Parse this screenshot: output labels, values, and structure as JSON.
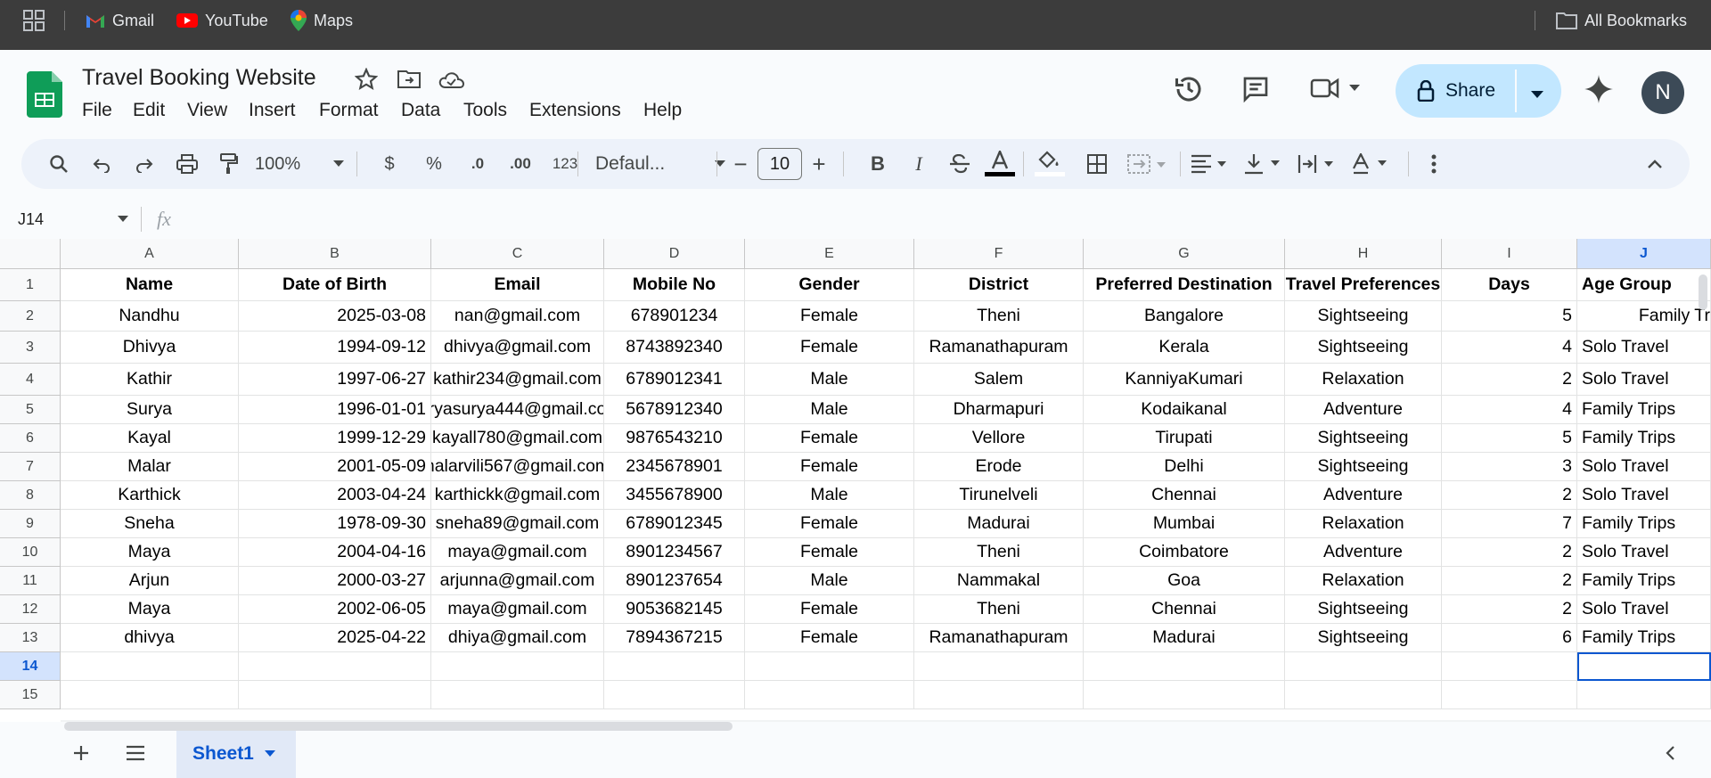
{
  "bookmarks": {
    "gmail": "Gmail",
    "youtube": "YouTube",
    "maps": "Maps",
    "all": "All Bookmarks"
  },
  "doc": {
    "title": "Travel Booking Website",
    "avatar": "N",
    "share": "Share"
  },
  "menu": [
    "File",
    "Edit",
    "View",
    "Insert",
    "Format",
    "Data",
    "Tools",
    "Extensions",
    "Help"
  ],
  "toolbar": {
    "zoom": "100%",
    "currency": "$",
    "percent": "%",
    "dec_decrease": ".0",
    "dec_increase": ".00",
    "format_123": "123",
    "font": "Defaul...",
    "font_size": "10",
    "minus": "−",
    "plus": "+",
    "bold": "B",
    "italic": "I"
  },
  "formula": {
    "cell_ref": "J14",
    "fx": "fx",
    "value": ""
  },
  "columns": [
    "A",
    "B",
    "C",
    "D",
    "E",
    "F",
    "G",
    "H",
    "I",
    "J"
  ],
  "rows": [
    "1",
    "2",
    "3",
    "4",
    "5",
    "6",
    "7",
    "8",
    "9",
    "10",
    "11",
    "12",
    "13",
    "14",
    "15"
  ],
  "headers": [
    "Name",
    "Date of Birth",
    "Email",
    "Mobile No",
    "Gender",
    "District",
    "Preferred Destination",
    "Travel Preferences",
    "Days",
    "Age Group"
  ],
  "data": [
    [
      "Nandhu",
      "2025-03-08",
      "nan@gmail.com",
      "678901234",
      "Female",
      "Theni",
      "Bangalore",
      "Sightseeing",
      "5",
      "Family Tr"
    ],
    [
      "Dhivya",
      "1994-09-12",
      "dhivya@gmail.com",
      "8743892340",
      "Female",
      "Ramanathapuram",
      "Kerala",
      "Sightseeing",
      "4",
      "Solo Travel"
    ],
    [
      "Kathir",
      "1997-06-27",
      "kathir234@gmail.com",
      "6789012341",
      "Male",
      "Salem",
      "KanniyaKumari",
      "Relaxation",
      "2",
      "Solo Travel"
    ],
    [
      "Surya",
      "1996-01-01",
      "ryasurya444@gmail.co",
      "5678912340",
      "Male",
      "Dharmapuri",
      "Kodaikanal",
      "Adventure",
      "4",
      "Family Trips"
    ],
    [
      "Kayal",
      "1999-12-29",
      "kayall780@gmail.com",
      "9876543210",
      "Female",
      "Vellore",
      "Tirupati",
      "Sightseeing",
      "5",
      "Family Trips"
    ],
    [
      "Malar",
      "2001-05-09",
      "nalarvili567@gmail.com",
      "2345678901",
      "Female",
      "Erode",
      "Delhi",
      "Sightseeing",
      "3",
      "Solo Travel"
    ],
    [
      "Karthick",
      "2003-04-24",
      "karthickk@gmail.com",
      "3455678900",
      "Male",
      "Tirunelveli",
      "Chennai",
      "Adventure",
      "2",
      "Solo Travel"
    ],
    [
      "Sneha",
      "1978-09-30",
      "sneha89@gmail.com",
      "6789012345",
      "Female",
      "Madurai",
      "Mumbai",
      "Relaxation",
      "7",
      "Family Trips"
    ],
    [
      "Maya",
      "2004-04-16",
      "maya@gmail.com",
      "8901234567",
      "Female",
      "Theni",
      "Coimbatore",
      "Adventure",
      "2",
      "Solo Travel"
    ],
    [
      "Arjun",
      "2000-03-27",
      "arjunna@gmail.com",
      "8901237654",
      "Male",
      "Nammakal",
      "Goa",
      "Relaxation",
      "2",
      "Family Trips"
    ],
    [
      "Maya",
      "2002-06-05",
      "maya@gmail.com",
      "9053682145",
      "Female",
      "Theni",
      "Chennai",
      "Sightseeing",
      "2",
      "Solo Travel"
    ],
    [
      "dhivya",
      "2025-04-22",
      "dhiya@gmail.com",
      "7894367215",
      "Female",
      "Ramanathapuram",
      "Madurai",
      "Sightseeing",
      "6",
      "Family Trips"
    ]
  ],
  "sheet": {
    "tab": "Sheet1"
  },
  "colors": {
    "accent": "#0b57d0",
    "share_bg": "#c2e7ff",
    "selected_col": "#d3e3fd",
    "sheets_green": "#0f9d58"
  }
}
